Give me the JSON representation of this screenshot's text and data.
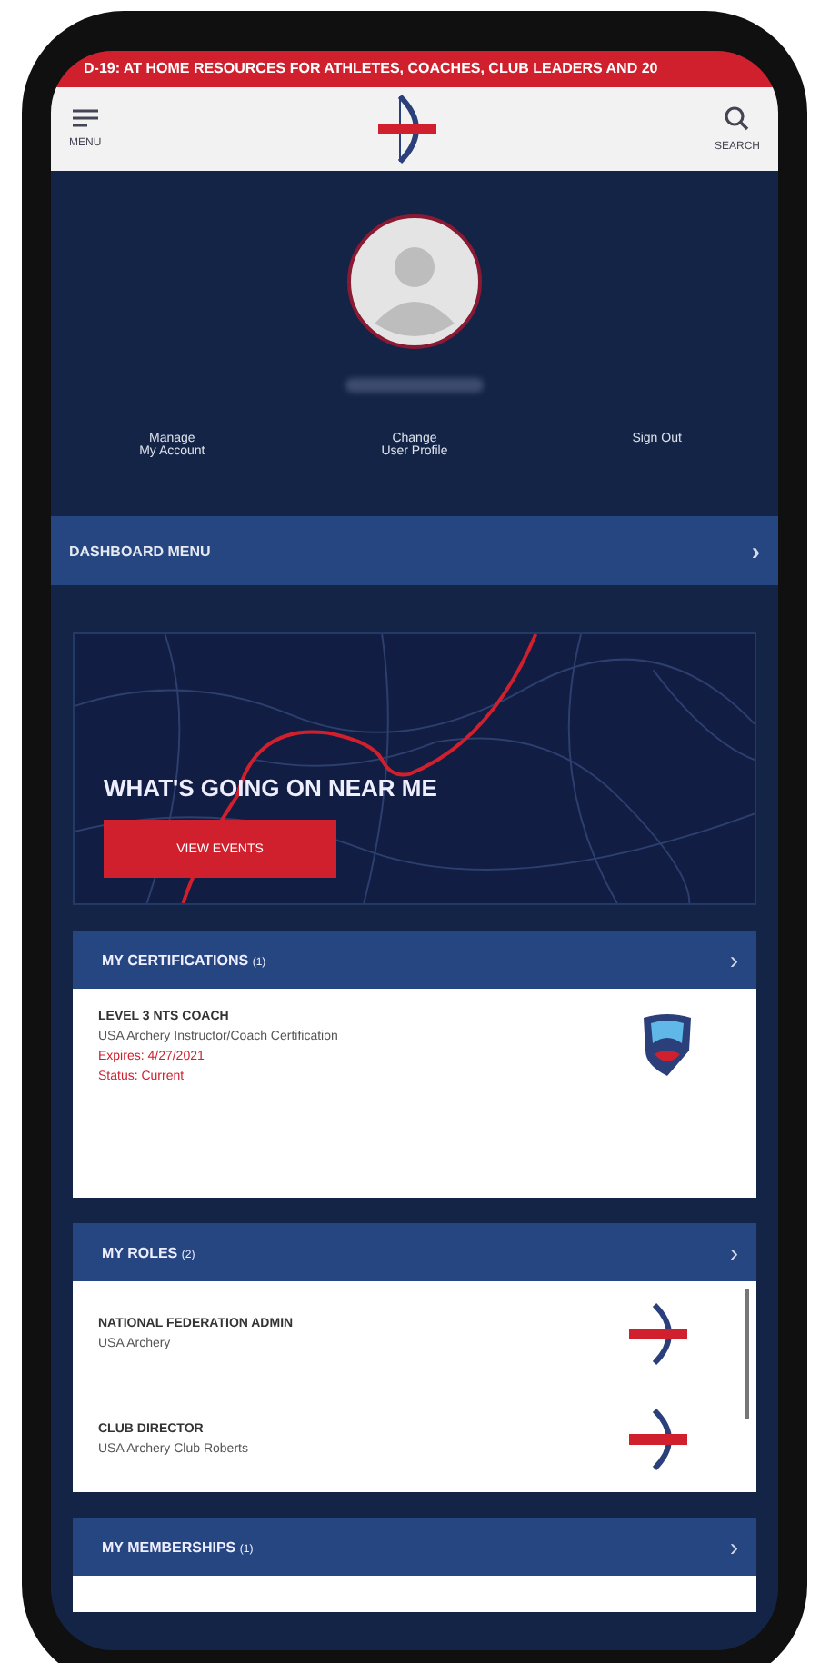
{
  "banner": {
    "text": "D-19: AT HOME RESOURCES FOR ATHLETES, COACHES, CLUB LEADERS AND 20"
  },
  "header": {
    "menu_label": "MENU",
    "search_label": "SEARCH"
  },
  "profile": {
    "actions": [
      {
        "label": "Manage\nMy Account"
      },
      {
        "label": "Change\nUser Profile"
      },
      {
        "label": "Sign Out"
      }
    ]
  },
  "dashboard_menu": {
    "label": "DASHBOARD MENU",
    "chevron": "›"
  },
  "promo": {
    "title": "WHAT'S GOING ON NEAR ME",
    "button": "VIEW EVENTS"
  },
  "sections": [
    {
      "title": "MY CERTIFICATIONS",
      "count": "(1)",
      "chevron": "›",
      "items": [
        {
          "kind": "certification",
          "title": "LEVEL 3 NTS COACH",
          "subtitle": "USA Archery Instructor/Coach Certification",
          "expires": "Expires: 4/27/2021",
          "status": "Status: Current"
        }
      ]
    },
    {
      "title": "MY ROLES",
      "count": "(2)",
      "chevron": "›",
      "items": [
        {
          "kind": "role",
          "title": "NATIONAL FEDERATION ADMIN",
          "subtitle": "USA Archery"
        },
        {
          "kind": "role",
          "title": "CLUB DIRECTOR",
          "subtitle": "USA Archery Club Roberts"
        }
      ]
    },
    {
      "title": "MY MEMBERSHIPS",
      "count": "(1)",
      "chevron": "›"
    }
  ]
}
